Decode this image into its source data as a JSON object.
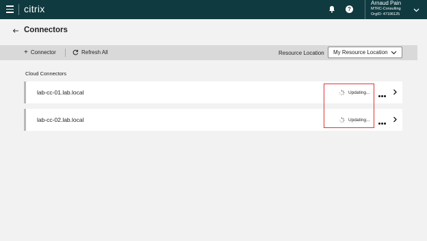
{
  "header": {
    "logo": "citrix",
    "user_name": "Arnaud Pain",
    "org_name": "MTRC-Consulting",
    "org_id": "OrgID: 47196125"
  },
  "page": {
    "title": "Connectors"
  },
  "toolbar": {
    "add_connector": "Connector",
    "refresh_all": "Refresh All",
    "resource_location_label": "Resource Location",
    "resource_location_value": "My Resource Location"
  },
  "section": {
    "title": "Cloud Connectors"
  },
  "connectors": [
    {
      "name": "lab-cc-01.lab.local",
      "status": "Updating..."
    },
    {
      "name": "lab-cc-02.lab.local",
      "status": "Updating..."
    }
  ],
  "colors": {
    "topbar": "#0f3a40",
    "highlight": "#dd3333"
  }
}
